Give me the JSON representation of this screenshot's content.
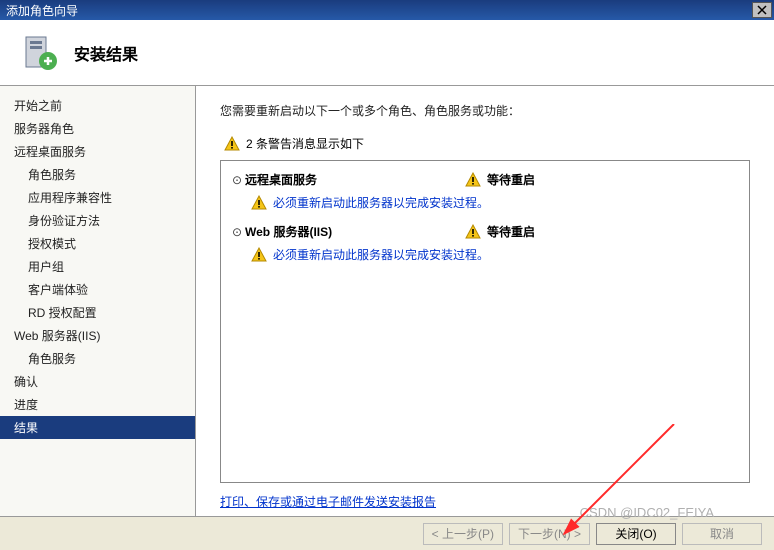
{
  "window": {
    "title": "添加角色向导"
  },
  "header": {
    "title": "安装结果"
  },
  "sidebar": {
    "items": [
      {
        "label": "开始之前",
        "sub": false
      },
      {
        "label": "服务器角色",
        "sub": false
      },
      {
        "label": "远程桌面服务",
        "sub": false
      },
      {
        "label": "角色服务",
        "sub": true
      },
      {
        "label": "应用程序兼容性",
        "sub": true
      },
      {
        "label": "身份验证方法",
        "sub": true
      },
      {
        "label": "授权模式",
        "sub": true
      },
      {
        "label": "用户组",
        "sub": true
      },
      {
        "label": "客户端体验",
        "sub": true
      },
      {
        "label": "RD 授权配置",
        "sub": true
      },
      {
        "label": "Web 服务器(IIS)",
        "sub": false
      },
      {
        "label": "角色服务",
        "sub": true
      },
      {
        "label": "确认",
        "sub": false
      },
      {
        "label": "进度",
        "sub": false
      },
      {
        "label": "结果",
        "sub": false,
        "active": true
      }
    ]
  },
  "content": {
    "intro": "您需要重新启动以下一个或多个角色、角色服务或功能：",
    "warning_summary": "2 条警告消息显示如下",
    "services": [
      {
        "name": "远程桌面服务",
        "status": "等待重启",
        "message": "必须重新启动此服务器以完成安装过程。"
      },
      {
        "name": "Web 服务器(IIS)",
        "status": "等待重启",
        "message": "必须重新启动此服务器以完成安装过程。"
      }
    ],
    "print_link": "打印、保存或通过电子邮件发送安装报告"
  },
  "footer": {
    "prev": "< 上一步(P)",
    "next": "下一步(N) >",
    "close": "关闭(O)",
    "cancel": "取消"
  },
  "watermark": {
    "csdn": "CSDN @IDC02_FEIYA"
  },
  "icons": {
    "warning_color": "#f5c518"
  }
}
